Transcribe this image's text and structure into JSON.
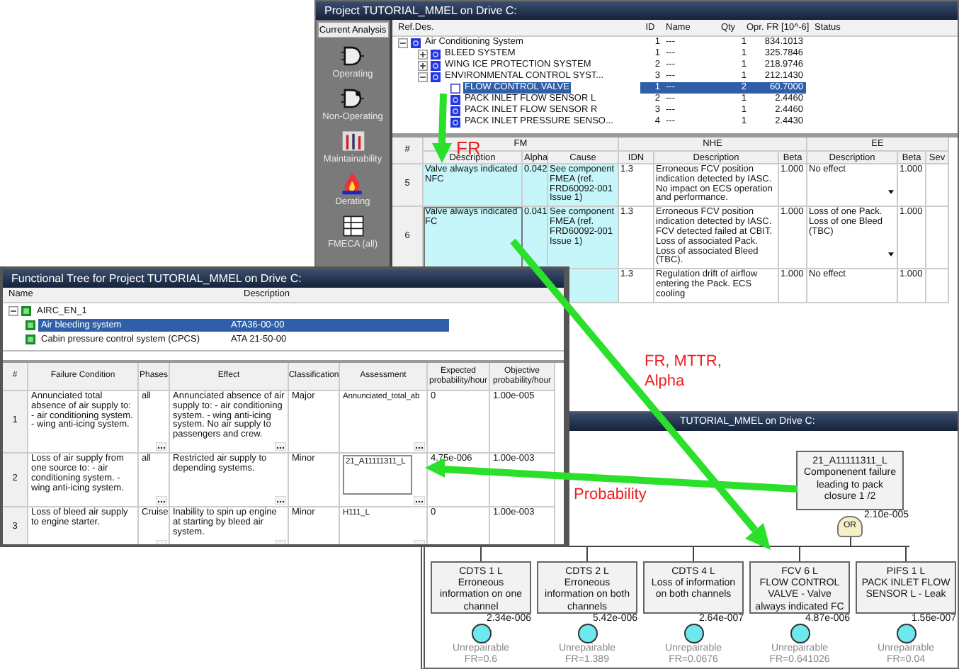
{
  "project_window": {
    "title": "Project TUTORIAL_MMEL on Drive C:",
    "sidebar": {
      "header": "Current Analysis",
      "items": [
        {
          "label": "Operating",
          "kind": "gate"
        },
        {
          "label": "Non-Operating",
          "kind": "gate-off"
        },
        {
          "label": "Maintainability",
          "kind": "tools"
        },
        {
          "label": "Derating",
          "kind": "fire"
        },
        {
          "label": "FMECA (all)",
          "kind": "table"
        }
      ]
    },
    "tree": {
      "columns": [
        "Ref.Des.",
        "ID",
        "Name",
        "Qty",
        "Opr. FR [10^-6]",
        "Status"
      ],
      "rows": [
        {
          "ref": "Air Conditioning System",
          "id": "1",
          "name": "---",
          "qty": "1",
          "fr": "834.1013",
          "selected": false,
          "expanded": true,
          "children": [
            {
              "ref": "BLEED SYSTEM",
              "id": "1",
              "name": "---",
              "qty": "1",
              "fr": "325.7846",
              "selected": false,
              "expanded": false
            },
            {
              "ref": "WING ICE PROTECTION SYSTEM",
              "id": "2",
              "name": "---",
              "qty": "1",
              "fr": "218.9746",
              "selected": false,
              "expanded": false
            },
            {
              "ref": "ENVIRONMENTAL CONTROL SYST...",
              "id": "3",
              "name": "---",
              "qty": "1",
              "fr": "212.1430",
              "selected": false,
              "expanded": true,
              "children": [
                {
                  "ref": "FLOW CONTROL VALVE",
                  "id": "1",
                  "name": "---",
                  "qty": "2",
                  "fr": "60.7000",
                  "selected": true
                },
                {
                  "ref": "PACK INLET FLOW SENSOR L",
                  "id": "2",
                  "name": "---",
                  "qty": "1",
                  "fr": "2.4460",
                  "selected": false
                },
                {
                  "ref": "PACK INLET FLOW SENSOR R",
                  "id": "3",
                  "name": "---",
                  "qty": "1",
                  "fr": "2.4460",
                  "selected": false
                },
                {
                  "ref": "PACK INLET PRESSURE SENSO...",
                  "id": "4",
                  "name": "---",
                  "qty": "1",
                  "fr": "2.4430",
                  "selected": false
                }
              ]
            }
          ]
        }
      ]
    },
    "grid": {
      "groups": [
        {
          "label": "#"
        },
        {
          "label": "FM"
        },
        {
          "label": "NHE"
        },
        {
          "label": "EE"
        }
      ],
      "columns": [
        "Description",
        "Alpha",
        "Cause",
        "IDN",
        "Description",
        "Beta",
        "Description",
        "Beta",
        "Sev"
      ],
      "rows": [
        {
          "number": "5",
          "fm_description": "Valve always indicated NFC",
          "alpha": "0.042",
          "cause": "See component FMEA (ref. FRD60092-001 Issue 1)",
          "idn": "1.3",
          "nhe_description": "Erroneous FCV position indication detected by IASC. No impact on ECS operation and performance.",
          "nhe_beta": "1.000",
          "ee_description": "No effect",
          "ee_beta": "1.000",
          "selected": false
        },
        {
          "number": "6",
          "fm_description": "Valve always indicated FC",
          "alpha": "0.041",
          "cause": "See component FMEA (ref. FRD60092-001 Issue 1)",
          "idn": "1.3",
          "nhe_description": "Erroneous FCV position indication detected by IASC. FCV detected failed at CBIT. Loss of associated Pack. Loss of associated Bleed (TBC).",
          "nhe_beta": "1.000",
          "ee_description": "Loss of one Pack. Loss of one Bleed (TBC)",
          "ee_beta": "1.000",
          "selected": true
        },
        {
          "idn": "1.3",
          "nhe_description": "Regulation drift of airflow entering the Pack. ECS cooling",
          "nhe_beta": "1.000",
          "ee_description": "No effect",
          "ee_beta": "1.000"
        }
      ]
    }
  },
  "fault_tree_window": {
    "title": "TUTORIAL_MMEL on Drive C:",
    "top_event": {
      "name": "21_A11111311_L",
      "description": "Componenent failure leading to pack closure 1 /2",
      "value": "2.10e-005",
      "gate": "OR"
    },
    "events": [
      {
        "name": "CDTS 1 L",
        "description": "Erroneous information on one channel",
        "value": "2.34e-006",
        "status": "Unrepairable",
        "fr": "FR=0.6"
      },
      {
        "name": "CDTS 2 L",
        "description": "Erroneous information on both channels",
        "value": "5.42e-006",
        "status": "Unrepairable",
        "fr": "FR=1.389"
      },
      {
        "name": "CDTS 4 L",
        "description": "Loss of information on both channels",
        "value": "2.64e-007",
        "status": "Unrepairable",
        "fr": "FR=0.0676"
      },
      {
        "name": "FCV 6 L",
        "description": "FLOW CONTROL VALVE - Valve always indicated FC",
        "value": "4.87e-006",
        "status": "Unrepairable",
        "fr": "FR=0.641026"
      },
      {
        "name": "PIFS 1 L",
        "description": "PACK INLET FLOW SENSOR L - Leak",
        "value": "1.56e-007",
        "status": "Unrepairable",
        "fr": "FR=0.04"
      }
    ]
  },
  "functional_tree_window": {
    "title": "Functional Tree for Project TUTORIAL_MMEL on Drive C:",
    "tree": {
      "columns": [
        "Name",
        "Description"
      ],
      "rows": [
        {
          "name": "AIRC_EN_1",
          "description": "",
          "selected": false,
          "expanded": true,
          "children": [
            {
              "name": "Air bleeding system",
              "description": "ATA36-00-00",
              "selected": true
            },
            {
              "name": "Cabin pressure control system (CPCS)",
              "description": "ATA 21-50-00",
              "selected": false
            }
          ]
        }
      ]
    },
    "grid": {
      "columns": [
        "#",
        "Failure Condition",
        "Phases",
        "Effect",
        "Classification",
        "Assessment",
        "Expected probability/hour",
        "Objective probability/hour"
      ],
      "rows": [
        {
          "number": "1",
          "condition": "Annunciated total absence of air supply to: - air conditioning system. - wing anti-icing system.",
          "phases": "all",
          "effect": "Annunciated absence of air supply to: - air conditioning system. - wing anti-icing system. No air supply to passengers and crew.",
          "classification": "Major",
          "assessment": "Annunciated_total_ab",
          "expected": "0",
          "objective": "1.00e-005",
          "selected": false
        },
        {
          "number": "2",
          "condition": "Loss of air supply from one source to: - air conditioning system. - wing anti-icing system.",
          "phases": "all",
          "effect": "Restricted air supply to depending systems.",
          "classification": "Minor",
          "assessment": "21_A11111311_L",
          "expected": "4.75e-006",
          "objective": "1.00e-003",
          "selected": true
        },
        {
          "number": "3",
          "condition": "Loss of bleed air supply to engine starter.",
          "phases": "Cruise",
          "effect": "Inability to spin up engine at starting by bleed air system.",
          "classification": "Minor",
          "assessment": "H111_L",
          "expected": "0",
          "objective": "1.00e-003",
          "selected": false
        }
      ]
    }
  },
  "annotations": [
    {
      "text": "FR",
      "kind": "fr"
    },
    {
      "text": "FR, MTTR, Alpha",
      "kind": "mttr"
    },
    {
      "text": "Probability",
      "kind": "prob"
    }
  ]
}
